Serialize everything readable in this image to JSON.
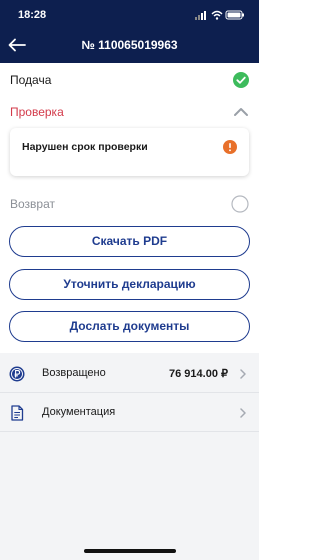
{
  "status_bar": {
    "time": "18:28"
  },
  "header": {
    "title": "№ 110065019963"
  },
  "steps": [
    {
      "label": "Подача",
      "state": "done"
    },
    {
      "label": "Проверка",
      "state": "expanded"
    },
    {
      "label": "Возврат",
      "state": "pending"
    }
  ],
  "alert_card": {
    "text": "Нарушен срок проверки"
  },
  "buttons": [
    {
      "label": "Скачать PDF"
    },
    {
      "label": "Уточнить декларацию"
    },
    {
      "label": "Дослать документы"
    }
  ],
  "list": [
    {
      "label": "Возвращено",
      "value": "76 914.00 ₽",
      "icon": "ruble-coin-icon"
    },
    {
      "label": "Документация",
      "value": "",
      "icon": "document-icon"
    }
  ],
  "colors": {
    "header": "#0d1f4f",
    "accent": "#1f3c8f",
    "success": "#3dbb5c",
    "warning": "#e8702a",
    "error_text": "#d33a4a"
  }
}
